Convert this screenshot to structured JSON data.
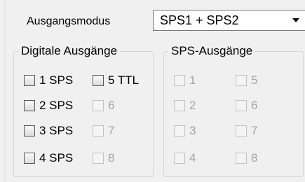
{
  "output_mode": {
    "label": "Ausgangsmodus",
    "selected": "SPS1 + SPS2"
  },
  "digital_outputs": {
    "title": "Digitale Ausgänge",
    "checkboxes": [
      {
        "label": "1 SPS",
        "checked": false,
        "enabled": true
      },
      {
        "label": "5 TTL",
        "checked": false,
        "enabled": true
      },
      {
        "label": "2 SPS",
        "checked": false,
        "enabled": true
      },
      {
        "label": "6",
        "checked": false,
        "enabled": false
      },
      {
        "label": "3 SPS",
        "checked": false,
        "enabled": true
      },
      {
        "label": "7",
        "checked": false,
        "enabled": false
      },
      {
        "label": "4 SPS",
        "checked": false,
        "enabled": true
      },
      {
        "label": "8",
        "checked": false,
        "enabled": false
      }
    ]
  },
  "sps_outputs": {
    "title": "SPS-Ausgänge",
    "checkboxes": [
      {
        "label": "1",
        "checked": false,
        "enabled": false
      },
      {
        "label": "5",
        "checked": false,
        "enabled": false
      },
      {
        "label": "2",
        "checked": false,
        "enabled": false
      },
      {
        "label": "6",
        "checked": false,
        "enabled": false
      },
      {
        "label": "3",
        "checked": false,
        "enabled": false
      },
      {
        "label": "7",
        "checked": false,
        "enabled": false
      },
      {
        "label": "4",
        "checked": false,
        "enabled": false
      },
      {
        "label": "8",
        "checked": false,
        "enabled": false
      }
    ]
  }
}
